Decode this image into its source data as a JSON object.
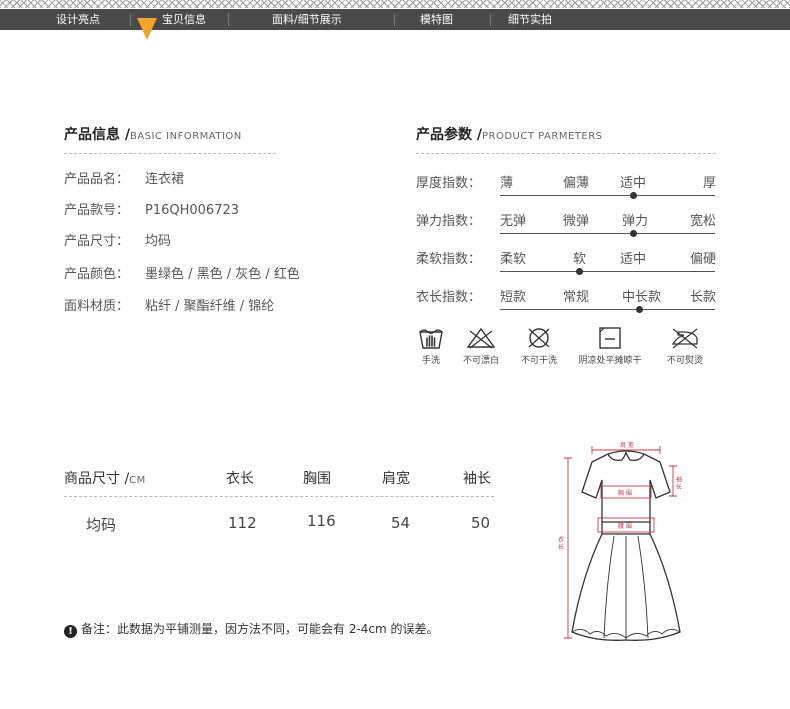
{
  "nav": {
    "items": [
      "设计亮点",
      "宝贝信息",
      "面料/细节展示",
      "模特图",
      "细节实拍"
    ]
  },
  "info": {
    "title": "产品信息 /",
    "title_en": "BASIC INFORMATION",
    "rows": [
      {
        "label": "产品品名：",
        "value": "连衣裙"
      },
      {
        "label": "产品款号：",
        "value": "P16QH006723"
      },
      {
        "label": "产品尺寸：",
        "value": "均码"
      },
      {
        "label": "产品颜色：",
        "value": "墨绿色 / 黑色 / 灰色 / 红色"
      },
      {
        "label": "面料材质：",
        "value": "粘纤 / 聚酯纤维 / 锦纶"
      }
    ]
  },
  "params": {
    "title": "产品参数 /",
    "title_en": "PRODUCT PARMETERS",
    "rows": [
      {
        "label": "厚度指数：",
        "options": [
          "薄",
          "偏薄",
          "适中",
          "厚"
        ],
        "selected": "适中",
        "level": 0.62
      },
      {
        "label": "弹力指数：",
        "options": [
          "无弹",
          "微弹",
          "弹力",
          "宽松"
        ],
        "selected": "弹力",
        "level": 0.62
      },
      {
        "label": "柔软指数：",
        "options": [
          "柔软",
          "软",
          "适中",
          "偏硬"
        ],
        "selected": "软",
        "level": 0.37
      },
      {
        "label": "衣长指数：",
        "options": [
          "短款",
          "常规",
          "中长款",
          "长款"
        ],
        "selected": "中长款",
        "level": 0.65
      }
    ]
  },
  "care": [
    {
      "icon": "hand-wash-icon",
      "label": "手洗"
    },
    {
      "icon": "no-bleach-icon",
      "label": "不可漂白"
    },
    {
      "icon": "no-dry-clean-icon",
      "label": "不可干洗"
    },
    {
      "icon": "shade-dry-icon",
      "label": "阴凉处平摊晾干"
    },
    {
      "icon": "no-iron-icon",
      "label": "不可熨烫"
    }
  ],
  "size_table": {
    "header_title": "商品尺寸 /",
    "header_unit": "CM",
    "columns": [
      "衣长",
      "胸围",
      "肩宽",
      "袖长"
    ],
    "rows": [
      {
        "size": "均码",
        "values": [
          "112",
          "116",
          "54",
          "50"
        ]
      }
    ]
  },
  "note": {
    "text": "备注：此数据为平铺测量，因方法不同，可能会有 2-4cm 的误差。"
  },
  "diagram": {
    "shoulder": "肩 宽",
    "sleeve": "袖 长",
    "chest": "胸 围",
    "waist": "腰 围",
    "length": "衣 长"
  },
  "colors": {
    "nav_bg": "#4a4a4a",
    "marker": "#f0a52a",
    "measure": "#c0394b"
  }
}
